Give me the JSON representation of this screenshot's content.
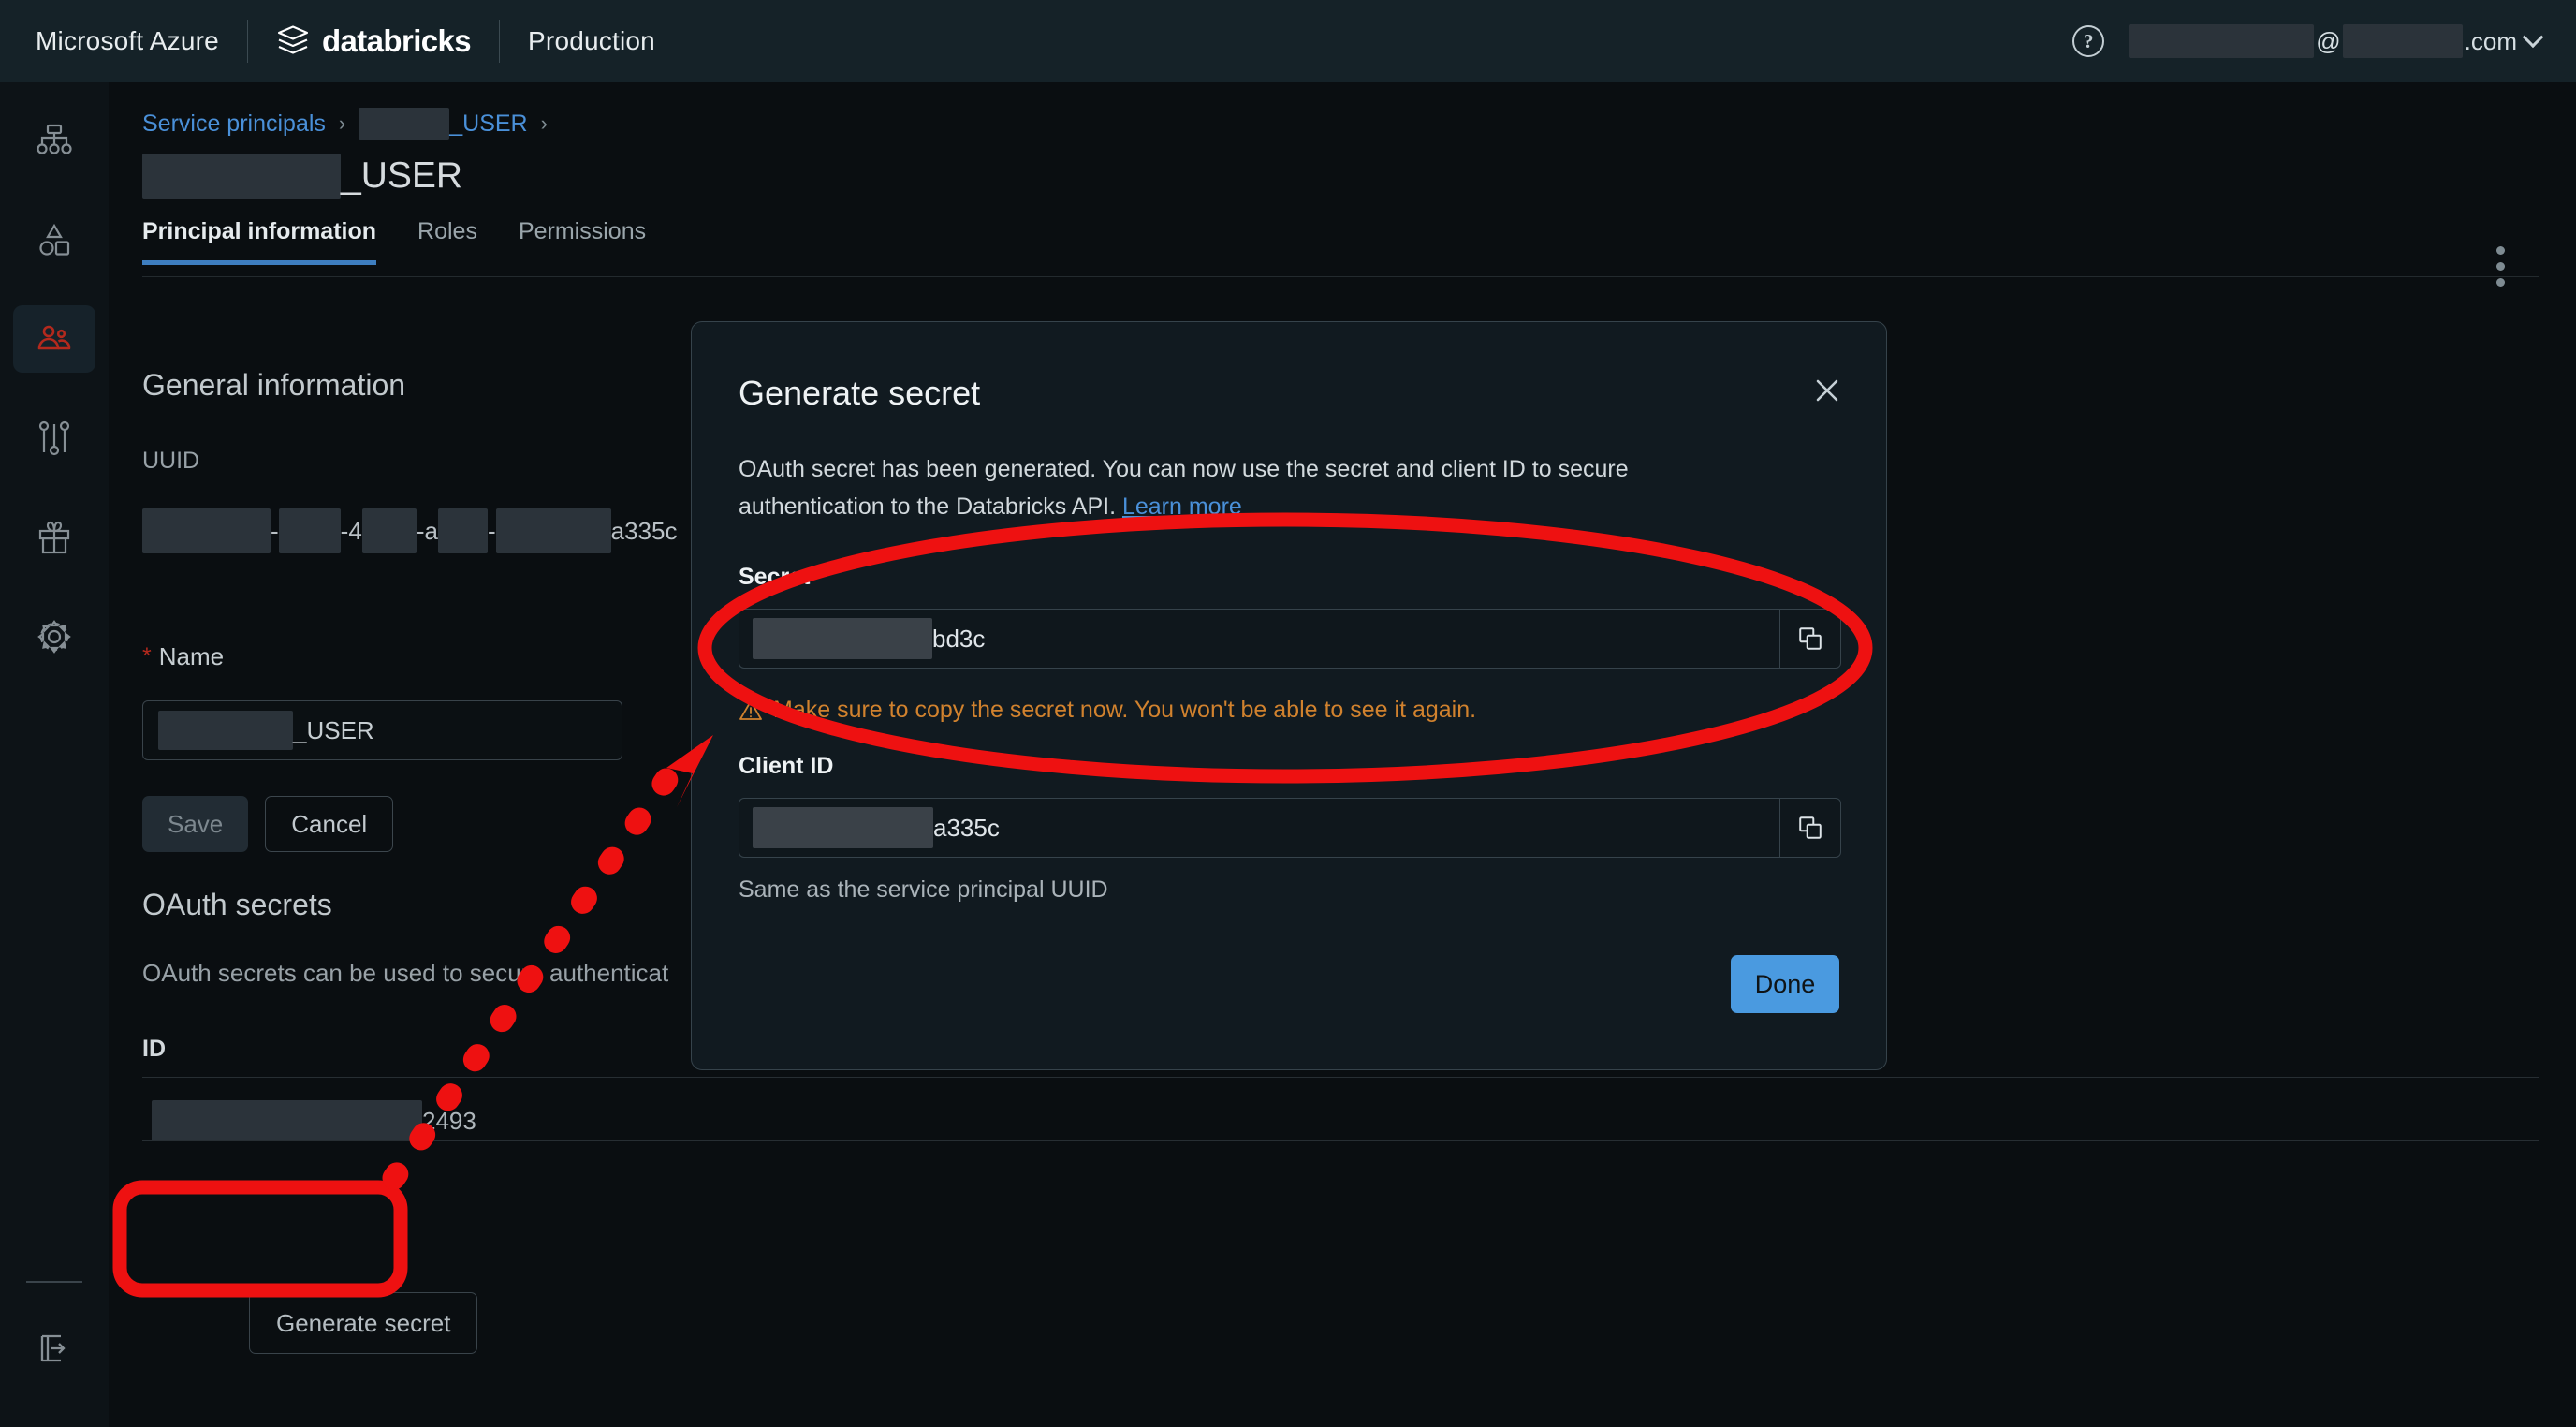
{
  "topbar": {
    "cloud_label": "Microsoft Azure",
    "brand": "databricks",
    "workspace": "Production",
    "help_icon": "question-mark-circle-icon",
    "account_at": "@",
    "account_domain": ".com",
    "chevron": "chevron-down-icon"
  },
  "sidebar": {
    "items": [
      {
        "icon": "workflow-network-icon",
        "active": false
      },
      {
        "icon": "shapes-catalog-icon",
        "active": false
      },
      {
        "icon": "people-identity-icon",
        "active": true
      },
      {
        "icon": "sliders-settings-icon",
        "active": false
      },
      {
        "icon": "gift-icon",
        "active": false
      },
      {
        "icon": "gear-icon",
        "active": false
      }
    ],
    "bottom_item": {
      "icon": "sign-out-icon"
    }
  },
  "breadcrumb": {
    "root": "Service principals",
    "separator": "›",
    "current_suffix": "_USER"
  },
  "page": {
    "title_suffix": "_USER",
    "kebab": "more-options-icon"
  },
  "tabs": [
    {
      "label": "Principal information",
      "active": true
    },
    {
      "label": "Roles",
      "active": false
    },
    {
      "label": "Permissions",
      "active": false
    }
  ],
  "general": {
    "heading": "General information",
    "uuid_label": "UUID",
    "uuid_dash": "-",
    "uuid_fragment_a": "4",
    "uuid_fragment_b": "a",
    "uuid_tail": "a335c"
  },
  "name_field": {
    "required_mark": "*",
    "label": "Name",
    "value_suffix": "_USER"
  },
  "buttons": {
    "save": "Save",
    "cancel": "Cancel",
    "generate_secret": "Generate secret"
  },
  "oauth": {
    "heading": "OAuth secrets",
    "description": "OAuth secrets can be used to secure authenticat",
    "table": {
      "columns": [
        "ID"
      ],
      "rows": [
        {
          "id_tail": "2493"
        }
      ]
    }
  },
  "modal": {
    "title": "Generate secret",
    "close_icon": "close-icon",
    "body_text": "OAuth secret has been generated. You can now use the secret and client ID to secure authentication to the Databricks API. ",
    "learn_more": "Learn more",
    "secret": {
      "label": "Secret",
      "value_tail": "bd3c",
      "copy_icon": "copy-icon",
      "warning_icon": "warning-triangle-icon",
      "warning_text": "Make sure to copy the secret now. You won't be able to see it again."
    },
    "client_id": {
      "label": "Client ID",
      "value_tail": "a335c",
      "copy_icon": "copy-icon",
      "hint": "Same as the service principal UUID"
    },
    "done": "Done"
  },
  "annotations": {
    "highlight_color": "#ee1111",
    "secret_ellipse": "red-ellipse-highlight",
    "generate_button_box": "red-rounded-rect-highlight",
    "arrow": "red-dashed-arrow"
  },
  "colors": {
    "accent_blue": "#4a90d9",
    "brand_red": "#b4291d",
    "warning_orange": "#d1822e",
    "topbar_bg": "#152228",
    "page_bg": "#0a0e11",
    "modal_bg": "#111a20"
  }
}
